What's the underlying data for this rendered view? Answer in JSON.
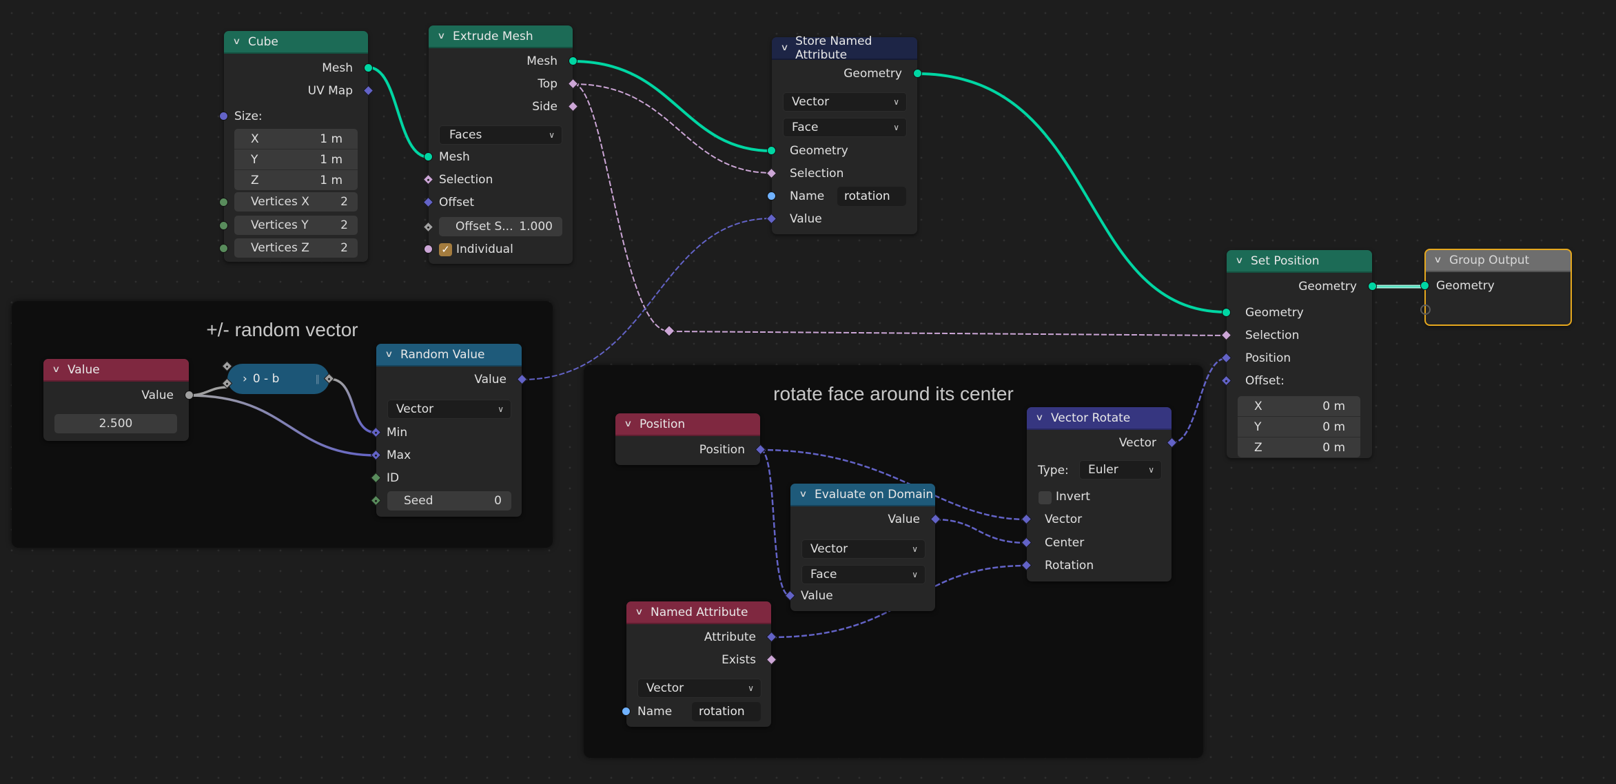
{
  "frames": {
    "random": {
      "label": "+/- random vector"
    },
    "rotate": {
      "label": "rotate face around its center"
    }
  },
  "colors": {
    "geometry_socket": "#00d6a3",
    "vector_socket": "#6363c7",
    "bool_socket": "#cca6d6",
    "float_socket": "#a1a1a1",
    "int_socket": "#598c5c",
    "string_socket": "#70b2ff",
    "geometry_header": "#1c6b56",
    "input_header": "#7f2840",
    "converter_header": "#1e5a7a",
    "attribute_header": "#1d2546",
    "vector_header": "#3b3b84",
    "output_header": "#6e6e6e",
    "active_outline": "#e6a81e"
  },
  "nodes": {
    "cube": {
      "title": "Cube",
      "outputs": [
        "Mesh",
        "UV Map"
      ],
      "size_label": "Size:",
      "size": [
        {
          "axis": "X",
          "value": "1 m"
        },
        {
          "axis": "Y",
          "value": "1 m"
        },
        {
          "axis": "Z",
          "value": "1 m"
        }
      ],
      "vertices": [
        {
          "label": "Vertices X",
          "value": "2"
        },
        {
          "label": "Vertices Y",
          "value": "2"
        },
        {
          "label": "Vertices Z",
          "value": "2"
        }
      ]
    },
    "extrude": {
      "title": "Extrude Mesh",
      "outputs": [
        "Mesh",
        "Top",
        "Side"
      ],
      "mode": "Faces",
      "inputs": [
        "Mesh",
        "Selection",
        "Offset"
      ],
      "offset_scale_label": "Offset S...",
      "offset_scale_value": "1.000",
      "individual_label": "Individual",
      "individual_checked": true
    },
    "store": {
      "title": "Store Named Attribute",
      "output": "Geometry",
      "data_type": "Vector",
      "domain": "Face",
      "inputs": [
        "Geometry",
        "Selection",
        "Name",
        "Value"
      ],
      "name_value": "rotation"
    },
    "set_position": {
      "title": "Set Position",
      "output": "Geometry",
      "inputs": [
        "Geometry",
        "Selection",
        "Position",
        "Offset:"
      ],
      "offset": [
        {
          "axis": "X",
          "value": "0 m"
        },
        {
          "axis": "Y",
          "value": "0 m"
        },
        {
          "axis": "Z",
          "value": "0 m"
        }
      ]
    },
    "group_output": {
      "title": "Group Output",
      "input": "Geometry"
    },
    "value": {
      "title": "Value",
      "output": "Value",
      "value": "2.500"
    },
    "math": {
      "label": "0 - b"
    },
    "random": {
      "title": "Random Value",
      "output": "Value",
      "data_type": "Vector",
      "inputs": [
        "Min",
        "Max",
        "ID"
      ],
      "seed_label": "Seed",
      "seed_value": "0"
    },
    "position": {
      "title": "Position",
      "output": "Position"
    },
    "evaluate": {
      "title": "Evaluate on Domain",
      "output": "Value",
      "data_type": "Vector",
      "domain": "Face",
      "input": "Value"
    },
    "vector_rotate": {
      "title": "Vector Rotate",
      "output": "Vector",
      "type_label": "Type:",
      "type_value": "Euler",
      "invert_label": "Invert",
      "invert_checked": false,
      "inputs": [
        "Vector",
        "Center",
        "Rotation"
      ]
    },
    "named_attr": {
      "title": "Named Attribute",
      "outputs": [
        "Attribute",
        "Exists"
      ],
      "data_type": "Vector",
      "name_label": "Name",
      "name_value": "rotation"
    }
  }
}
